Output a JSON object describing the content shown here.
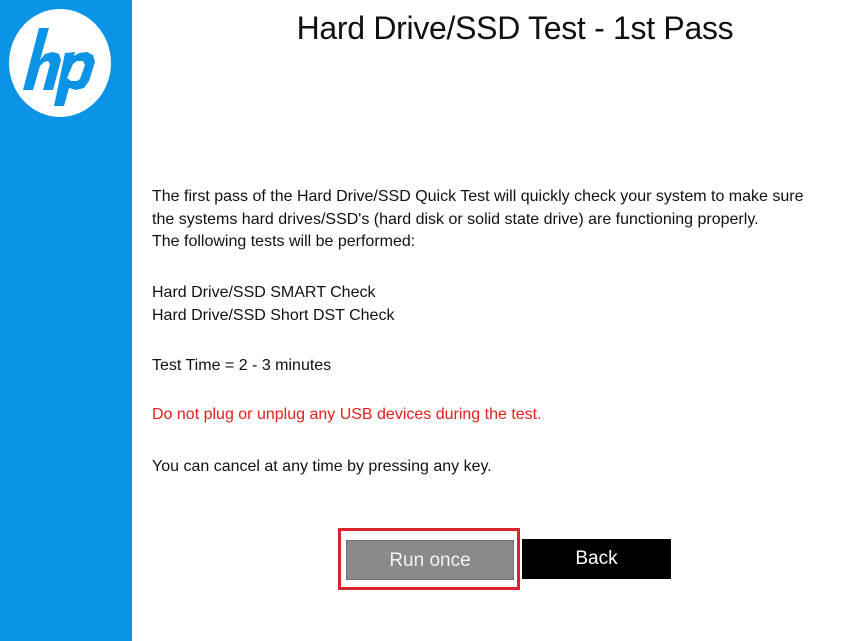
{
  "brand": {
    "logo_text": "hp",
    "sidebar_color": "#0b93e6"
  },
  "header": {
    "title": "Hard Drive/SSD Test - 1st Pass"
  },
  "body": {
    "intro_lines": [
      "The first pass of the Hard Drive/SSD Quick Test will quickly check your system to make sure",
      "the systems hard drives/SSD's (hard disk or solid state drive) are functioning properly.",
      "The following tests will be performed:"
    ],
    "tests": [
      "Hard Drive/SSD SMART Check",
      "Hard Drive/SSD Short DST Check"
    ],
    "test_time": "Test Time = 2 - 3 minutes",
    "warning": "Do not plug or unplug any USB devices during the test.",
    "warning_color": "#e3201b",
    "cancel_note": "You can cancel at any time by pressing any key."
  },
  "actions": {
    "run_once_label": "Run once",
    "back_label": "Back",
    "highlight_color": "#d9232f"
  }
}
